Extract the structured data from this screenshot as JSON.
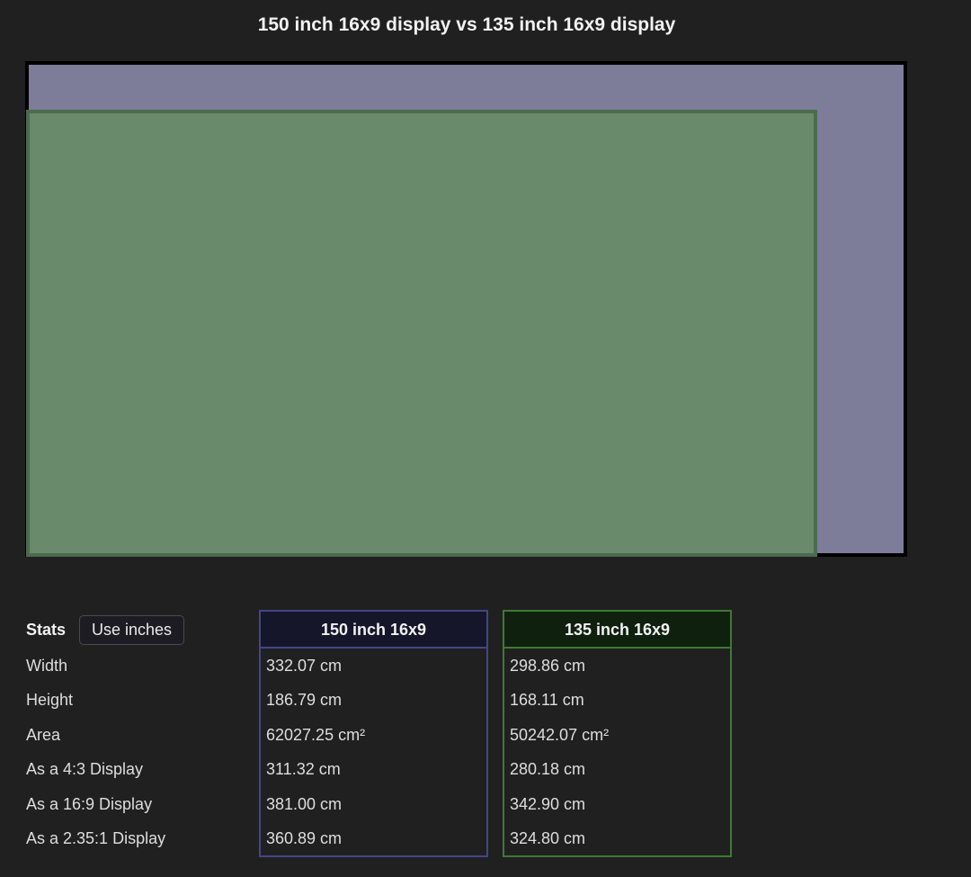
{
  "title": "150 inch 16x9 display vs 135 inch 16x9 display",
  "colors": {
    "background": "#202020",
    "display_a_fill": "#7d7d9a",
    "display_a_border": "#000000",
    "display_b_fill": "#6a8a6c",
    "display_b_border": "#4c6a4e",
    "column_a_border": "#454588",
    "column_b_border": "#3d7a34"
  },
  "stats": {
    "label": "Stats",
    "toggle_label": "Use inches",
    "rows": [
      "Width",
      "Height",
      "Area",
      "As a 4:3 Display",
      "As a 16:9 Display",
      "As a 2.35:1 Display"
    ]
  },
  "display_a": {
    "name": "150 inch 16x9",
    "values": [
      "332.07 cm",
      "186.79 cm",
      "62027.25 cm²",
      "311.32 cm",
      "381.00 cm",
      "360.89 cm"
    ]
  },
  "display_b": {
    "name": "135 inch 16x9",
    "values": [
      "298.86 cm",
      "168.11 cm",
      "50242.07 cm²",
      "280.18 cm",
      "342.90 cm",
      "324.80 cm"
    ]
  }
}
